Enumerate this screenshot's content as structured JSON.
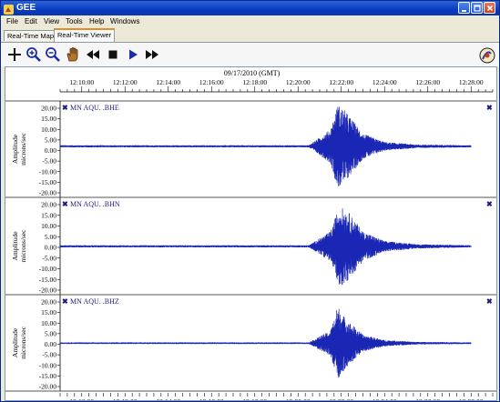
{
  "window": {
    "title": "GEE"
  },
  "menu": [
    "File",
    "Edit",
    "View",
    "Tools",
    "Help",
    "Windows"
  ],
  "tabs": [
    {
      "label": "Real-Time Map",
      "active": false
    },
    {
      "label": "Real-Time Viewer",
      "active": true
    }
  ],
  "toolbar": {
    "icons": [
      "crosshair-icon",
      "zoom-in-icon",
      "zoom-out-icon",
      "pan-hand-icon",
      "rewind-icon",
      "stop-icon",
      "play-icon",
      "fast-forward-icon"
    ],
    "accent_color": "#1a2fa0"
  },
  "viewer": {
    "date_label": "09/17/2010 (GMT)",
    "trace_color": "#1a26b4"
  },
  "chart_data": [
    {
      "type": "line",
      "channel": "MN AQU. .BHE",
      "ylabel": "Amplitude microns/sec",
      "x_ticks": [
        "12:10:00",
        "12:12:00",
        "12:14:00",
        "12:16:00",
        "12:18:00",
        "12:20:00",
        "12:22:00",
        "12:24:00",
        "12:26:00",
        "12:28:00"
      ],
      "y_ticks": [
        "20.00",
        "15.00",
        "10.00",
        "5.00",
        "0.00",
        "-5.00",
        "-10.00",
        "-15.00",
        "-20.00"
      ],
      "ylim": [
        -20,
        20
      ],
      "xlim": [
        "12:09:00",
        "12:29:00"
      ],
      "data_range": [
        "12:09:00",
        "12:28:00"
      ],
      "baseline": 2.0,
      "envelope": [
        {
          "t": "12:09:00",
          "amp": 0.5
        },
        {
          "t": "12:20:30",
          "amp": 0.5
        },
        {
          "t": "12:21:30",
          "amp": 8
        },
        {
          "t": "12:21:50",
          "amp": 20
        },
        {
          "t": "12:22:10",
          "amp": 17
        },
        {
          "t": "12:23:00",
          "amp": 6
        },
        {
          "t": "12:24:00",
          "amp": 2
        },
        {
          "t": "12:25:30",
          "amp": 0.8
        },
        {
          "t": "12:28:00",
          "amp": 0.5
        }
      ]
    },
    {
      "type": "line",
      "channel": "MN AQU. .BHN",
      "ylabel": "Amplitude microns/sec",
      "x_ticks": [
        "12:10:00",
        "12:12:00",
        "12:14:00",
        "12:16:00",
        "12:18:00",
        "12:20:00",
        "12:22:00",
        "12:24:00",
        "12:26:00",
        "12:28:00"
      ],
      "y_ticks": [
        "20.00",
        "15.00",
        "10.00",
        "5.00",
        "0.00",
        "-5.00",
        "-10.00",
        "-15.00",
        "-20.00"
      ],
      "ylim": [
        -20,
        20
      ],
      "xlim": [
        "12:09:00",
        "12:29:00"
      ],
      "data_range": [
        "12:09:00",
        "12:28:00"
      ],
      "baseline": 0.5,
      "envelope": [
        {
          "t": "12:09:00",
          "amp": 0.5
        },
        {
          "t": "12:20:30",
          "amp": 0.5
        },
        {
          "t": "12:21:30",
          "amp": 7
        },
        {
          "t": "12:21:55",
          "amp": 19
        },
        {
          "t": "12:22:20",
          "amp": 16
        },
        {
          "t": "12:23:00",
          "amp": 7
        },
        {
          "t": "12:24:00",
          "amp": 2.5
        },
        {
          "t": "12:25:30",
          "amp": 1
        },
        {
          "t": "12:28:00",
          "amp": 0.5
        }
      ]
    },
    {
      "type": "line",
      "channel": "MN AQU. .BHZ",
      "ylabel": "Amplitude microns/sec",
      "x_ticks": [
        "12:10:00",
        "12:12:00",
        "12:14:00",
        "12:16:00",
        "12:18:00",
        "12:20:00",
        "12:22:00",
        "12:24:00",
        "12:26:00",
        "12:28:00"
      ],
      "y_ticks": [
        "20.00",
        "15.00",
        "10.00",
        "5.00",
        "0.00",
        "-5.00",
        "-10.00",
        "-15.00",
        "-20.00"
      ],
      "ylim": [
        -20,
        20
      ],
      "xlim": [
        "12:09:00",
        "12:29:00"
      ],
      "data_range": [
        "12:09:00",
        "12:28:00"
      ],
      "baseline": 0.5,
      "envelope": [
        {
          "t": "12:09:00",
          "amp": 0.4
        },
        {
          "t": "12:20:30",
          "amp": 0.4
        },
        {
          "t": "12:21:30",
          "amp": 6
        },
        {
          "t": "12:21:50",
          "amp": 18
        },
        {
          "t": "12:22:10",
          "amp": 12
        },
        {
          "t": "12:23:00",
          "amp": 4
        },
        {
          "t": "12:24:00",
          "amp": 1.5
        },
        {
          "t": "12:25:30",
          "amp": 0.6
        },
        {
          "t": "12:28:00",
          "amp": 0.4
        }
      ]
    }
  ]
}
